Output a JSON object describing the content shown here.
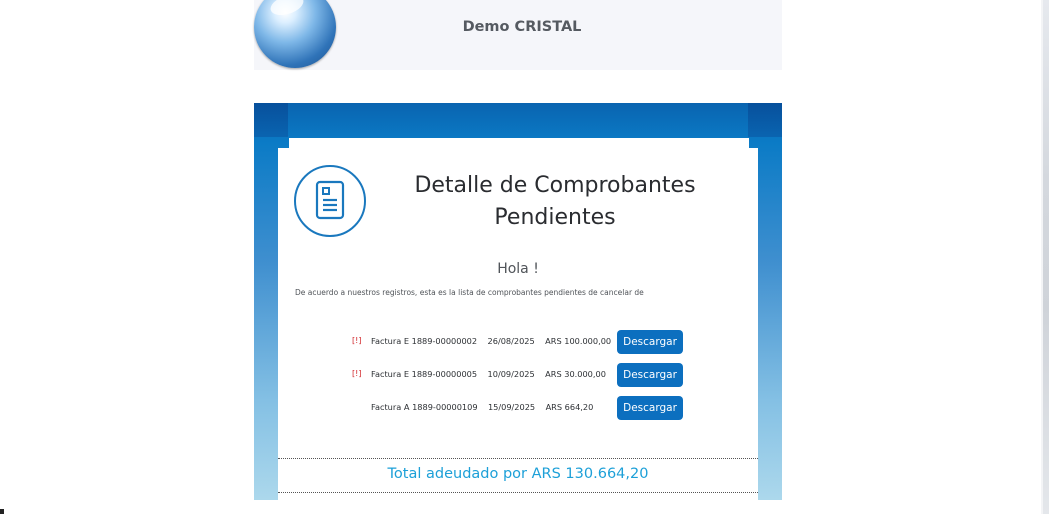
{
  "header": {
    "brand": "Demo CRISTAL"
  },
  "card": {
    "title_line1": "Detalle de Comprobantes",
    "title_line2": "Pendientes",
    "greeting": "Hola !",
    "intro": "De acuerdo a nuestros registros, esta es la lista de comprobantes pendientes de cancelar de"
  },
  "invoices": [
    {
      "warning": "[!]",
      "number": "Factura E 1889-00000002",
      "date": "26/08/2025",
      "amount": "ARS 100.000,00",
      "button": "Descargar"
    },
    {
      "warning": "[!]",
      "number": "Factura E 1889-00000005",
      "date": "10/09/2025",
      "amount": "ARS 30.000,00",
      "button": "Descargar"
    },
    {
      "warning": "",
      "number": "Factura A 1889-00000109",
      "date": "15/09/2025",
      "amount": "ARS 664,20",
      "button": "Descargar"
    }
  ],
  "total": "Total adeudado por ARS 130.664,20",
  "colors": {
    "accent": "#0c6fbf",
    "total_text": "#1da0d8",
    "warning": "#d2282c"
  },
  "icons": {
    "logo": "crystal-ball-logo",
    "document": "document-icon"
  }
}
